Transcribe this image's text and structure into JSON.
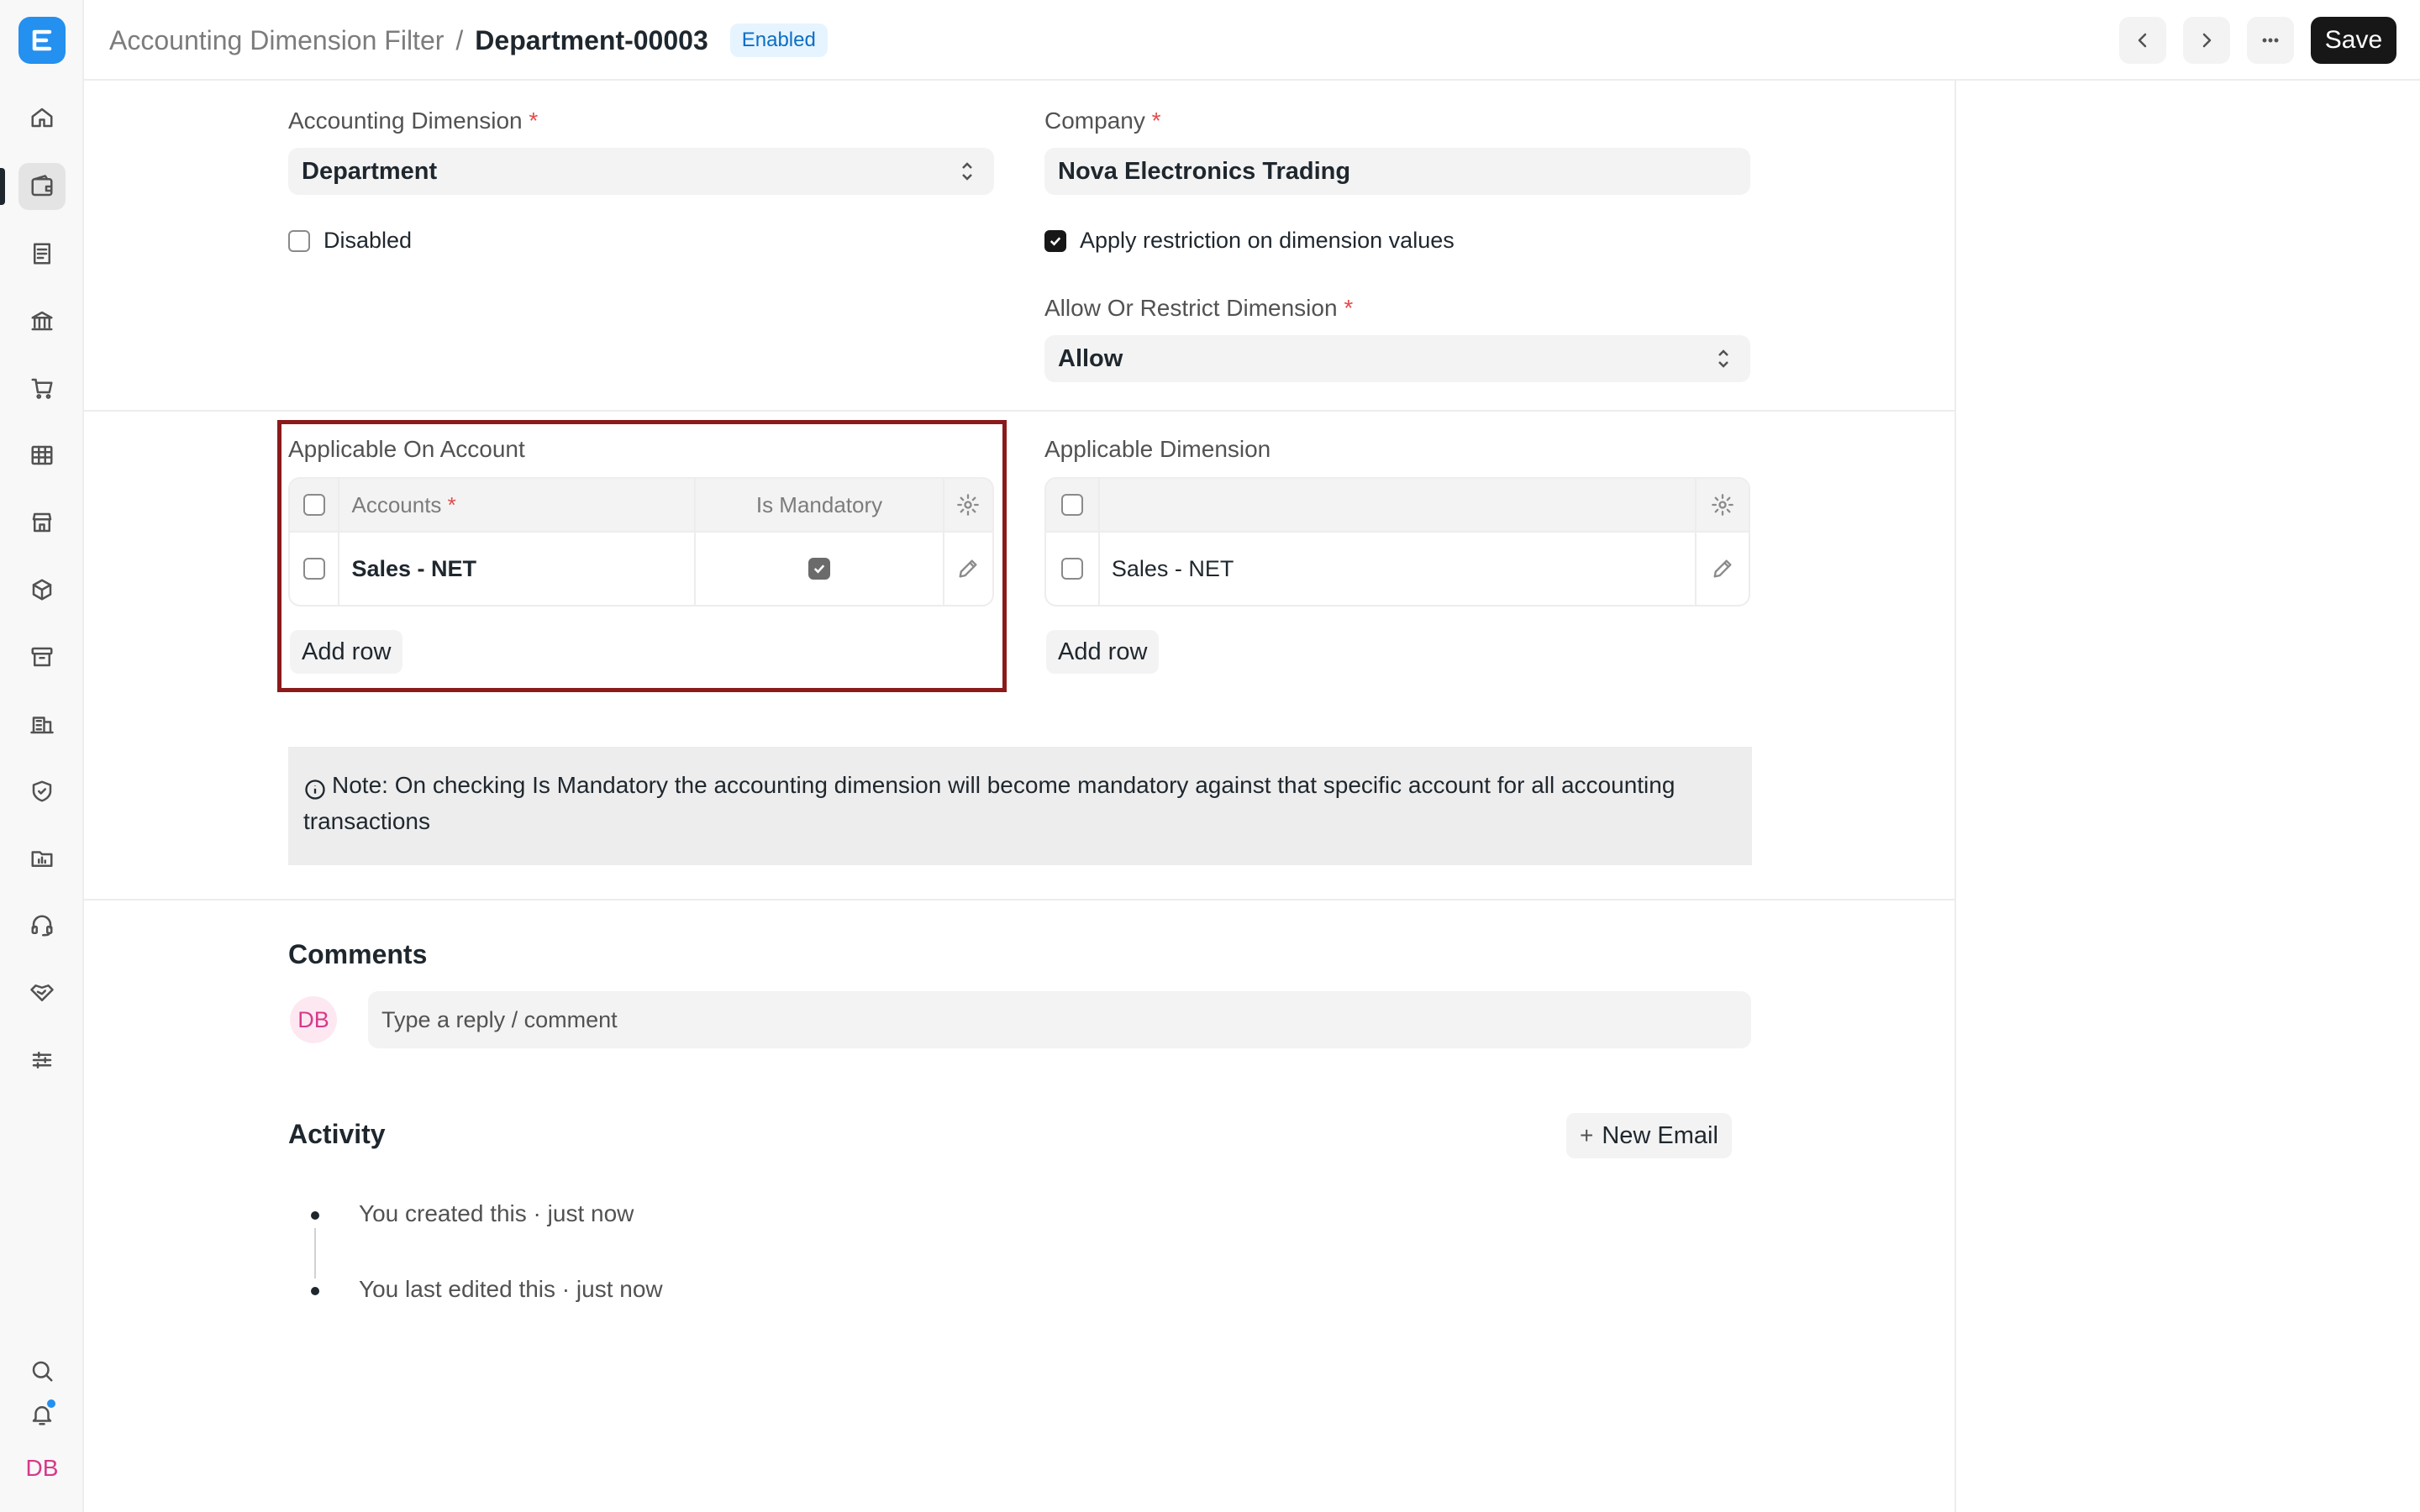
{
  "header": {
    "parent": "Accounting Dimension Filter",
    "separator": "/",
    "title": "Department-00003",
    "status": "Enabled",
    "save_label": "Save"
  },
  "sidebar": {
    "items": [
      {
        "icon": "home-icon"
      },
      {
        "icon": "wallet-icon",
        "active": true
      },
      {
        "icon": "receipt-icon"
      },
      {
        "icon": "bank-icon"
      },
      {
        "icon": "cart-icon"
      },
      {
        "icon": "table-icon"
      },
      {
        "icon": "store-icon"
      },
      {
        "icon": "package-icon"
      },
      {
        "icon": "archive-icon"
      },
      {
        "icon": "building-icon"
      },
      {
        "icon": "shield-icon"
      },
      {
        "icon": "folder-chart-icon"
      },
      {
        "icon": "headset-icon"
      },
      {
        "icon": "handshake-icon"
      },
      {
        "icon": "sliders-icon"
      }
    ],
    "avatar": "DB"
  },
  "form": {
    "accounting_dimension": {
      "label": "Accounting Dimension",
      "required": "*",
      "value": "Department"
    },
    "company": {
      "label": "Company",
      "required": "*",
      "value": "Nova Electronics Trading"
    },
    "disabled": {
      "label": "Disabled",
      "checked": false
    },
    "apply_restriction": {
      "label": "Apply restriction on dimension values",
      "checked": true
    },
    "allow_or_restrict": {
      "label": "Allow Or Restrict Dimension",
      "required": "*",
      "value": "Allow"
    }
  },
  "applicable_on_account": {
    "title": "Applicable On Account",
    "columns": {
      "accounts": "Accounts",
      "required": "*",
      "is_mandatory": "Is Mandatory"
    },
    "rows": [
      {
        "account": "Sales - NET",
        "is_mandatory": true
      }
    ],
    "add_row_label": "Add row"
  },
  "applicable_dimension": {
    "title": "Applicable Dimension",
    "rows": [
      {
        "value": "Sales - NET"
      }
    ],
    "add_row_label": "Add row"
  },
  "note": {
    "text": "Note: On checking Is Mandatory the accounting dimension will become mandatory against that specific account for all accounting transactions"
  },
  "comments": {
    "title": "Comments",
    "avatar": "DB",
    "placeholder": "Type a reply / comment"
  },
  "activity": {
    "title": "Activity",
    "new_email_label": "New Email",
    "items": [
      "You created this · just now",
      "You last edited this · just now"
    ]
  },
  "colors": {
    "accent": "#2490ef",
    "highlight_border": "#8b1a1a",
    "badge_bg": "#e6f4ff",
    "badge_text": "#0b6ec5"
  }
}
